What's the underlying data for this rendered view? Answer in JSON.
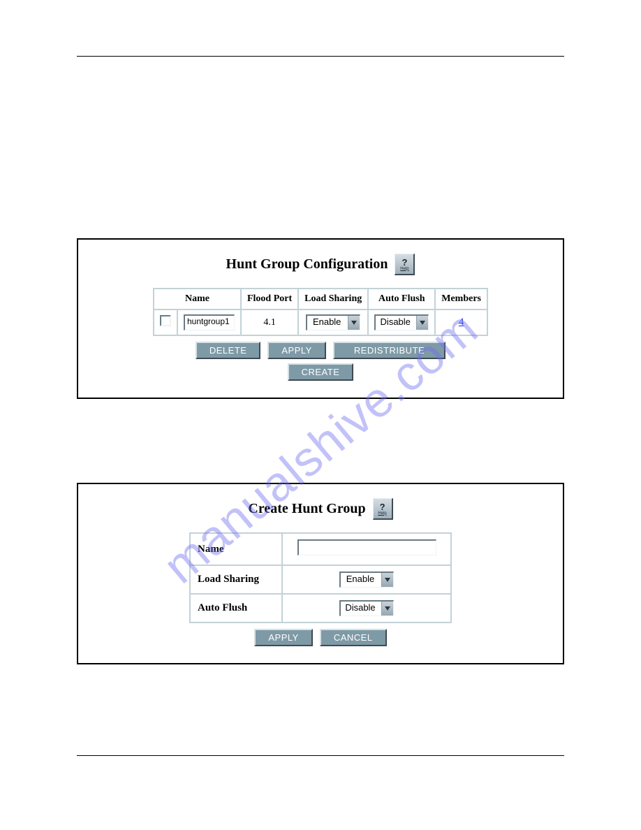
{
  "watermark": "manualshive.com",
  "config_panel": {
    "title": "Hunt Group Configuration",
    "help_label": "Help",
    "columns": {
      "name": "Name",
      "flood_port": "Flood Port",
      "load_sharing": "Load Sharing",
      "auto_flush": "Auto Flush",
      "members": "Members"
    },
    "rows": [
      {
        "name": "huntgroup1",
        "flood_port": "4.1",
        "load_sharing": "Enable",
        "auto_flush": "Disable",
        "members": "4"
      }
    ],
    "buttons": {
      "delete": "DELETE",
      "apply": "APPLY",
      "redistribute": "REDISTRIBUTE",
      "create": "CREATE"
    }
  },
  "create_panel": {
    "title": "Create Hunt Group",
    "help_label": "Help",
    "fields": {
      "name_label": "Name",
      "name_value": "",
      "load_sharing_label": "Load Sharing",
      "load_sharing_value": "Enable",
      "auto_flush_label": "Auto Flush",
      "auto_flush_value": "Disable"
    },
    "buttons": {
      "apply": "APPLY",
      "cancel": "CANCEL"
    }
  }
}
